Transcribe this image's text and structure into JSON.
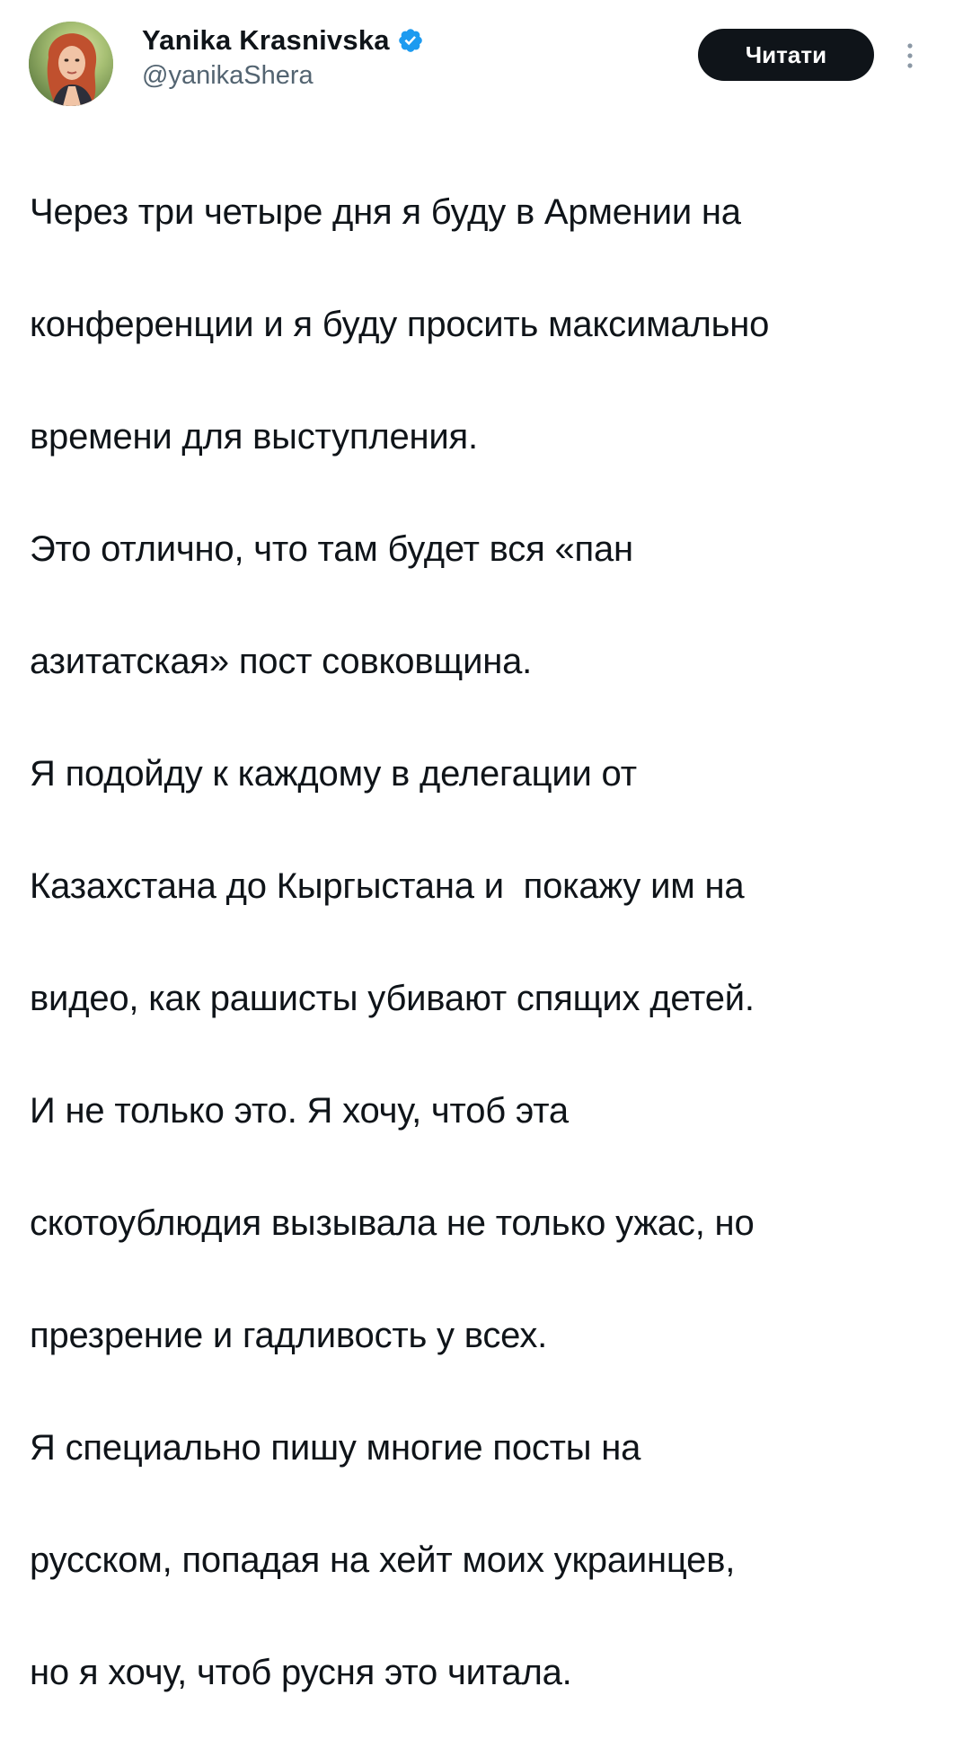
{
  "tweet": {
    "author": {
      "display_name": "Yanika Krasnivska",
      "handle": "@yanikaShera",
      "verified": true,
      "avatar_icon": "user-avatar-photo"
    },
    "actions": {
      "read_label": "Читати",
      "more_icon": "more-vertical-icon"
    },
    "lines": [
      "Через три четыре дня я буду в Армении на",
      "конференции и я буду просить максимально",
      "времени для выступления.",
      "Это отлично, что там будет вся «пан",
      "азитатская» пост совковщина.",
      "Я подойду к каждому в делегации от",
      "Казахстана до Кыргыстана и  покажу им на",
      "видео, как рашисты убивают спящих детей.",
      "И не только это. Я хочу, чтоб эта",
      "скотоублюдия вызывала не только ужас, но",
      "презрение и гадливость у всех.",
      "Я специально пишу многие посты на",
      "русском, попадая на хейт моих украинцев,",
      "но я хочу, чтоб русня это читала."
    ]
  },
  "colors": {
    "text_primary": "#0f1419",
    "text_secondary": "#536471",
    "verified_blue": "#1d9bf0",
    "button_bg": "#0f1419",
    "button_text": "#ffffff",
    "background": "#ffffff"
  }
}
